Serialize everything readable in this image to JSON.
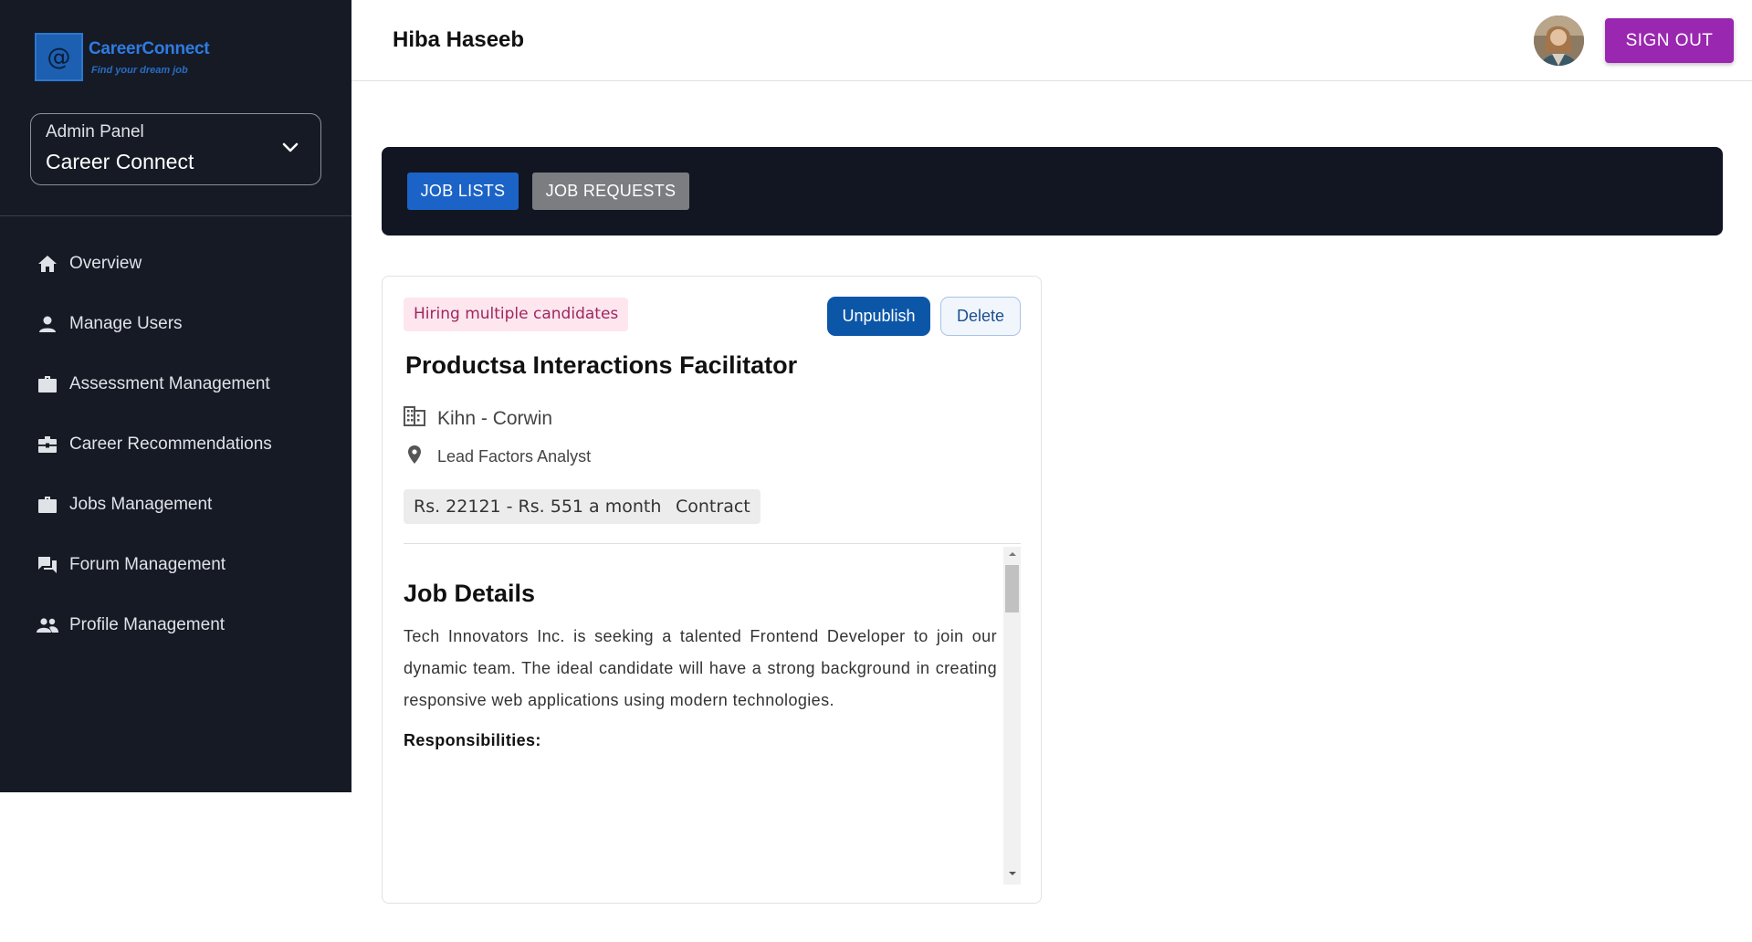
{
  "brand": {
    "name": "CareerConnect",
    "tagline": "Find your dream job",
    "logo_glyph": "@",
    "color": "#2f7be0"
  },
  "panel": {
    "label": "Admin Panel",
    "value": "Career Connect"
  },
  "sidebar": {
    "items": [
      {
        "label": "Overview",
        "icon": "home-icon"
      },
      {
        "label": "Manage Users",
        "icon": "person-icon"
      },
      {
        "label": "Assessment Management",
        "icon": "briefcase-icon"
      },
      {
        "label": "Career Recommendations",
        "icon": "medical-briefcase-icon"
      },
      {
        "label": "Jobs Management",
        "icon": "briefcase-icon"
      },
      {
        "label": "Forum Management",
        "icon": "forum-icon"
      },
      {
        "label": "Profile Management",
        "icon": "people-icon"
      }
    ]
  },
  "header": {
    "user_name": "Hiba Haseeb",
    "signout_label": "SIGN OUT",
    "signout_color": "#9a27b0"
  },
  "tabs": [
    {
      "label": "JOB LISTS",
      "active": true
    },
    {
      "label": "JOB REQUESTS",
      "active": false
    }
  ],
  "job": {
    "badge": "Hiring multiple candidates",
    "unpublish_label": "Unpublish",
    "delete_label": "Delete",
    "title": "Productsa Interactions Facilitator",
    "company": "Kihn - Corwin",
    "location": "Lead Factors Analyst",
    "salary": "Rs. 22121 - Rs. 551 a month",
    "type": "Contract",
    "details_heading": "Job Details",
    "description": "Tech Innovators Inc. is seeking a talented Frontend Developer to join our dynamic team. The ideal candidate will have a strong background in creating responsive web applications using modern technologies.",
    "responsibilities_heading": "Responsibilities:"
  }
}
